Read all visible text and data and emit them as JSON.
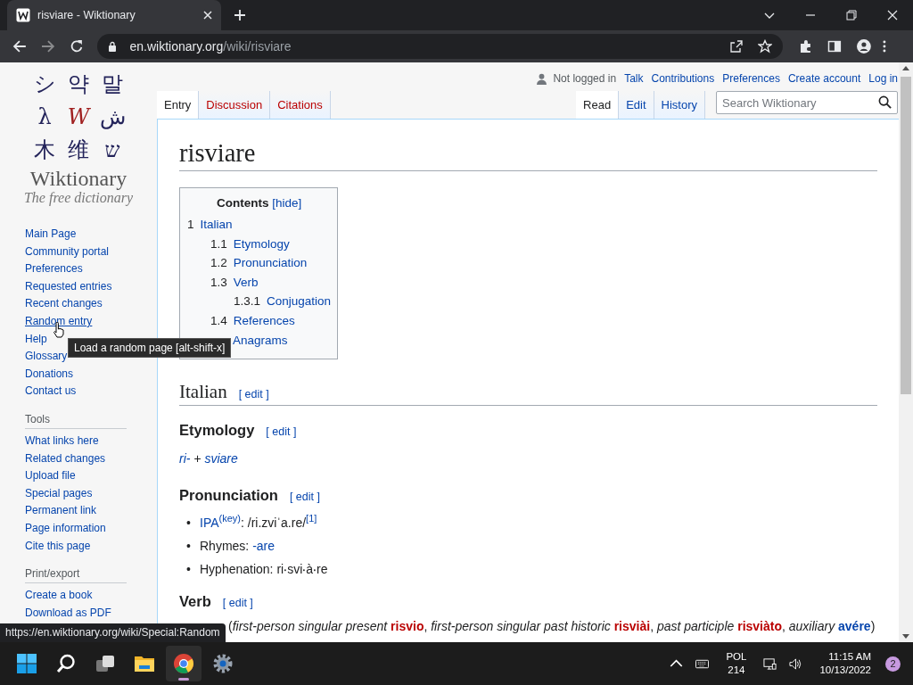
{
  "browser": {
    "tab_title": "risviare - Wiktionary",
    "url_host": "en.wiktionary.org",
    "url_path": "/wiki/risviare"
  },
  "logo": {
    "glyphs": [
      "シ",
      "약",
      "말",
      "λ",
      "W",
      "ش",
      "木",
      "维",
      "ש"
    ],
    "name": "Wiktionary",
    "tagline": "The free dictionary"
  },
  "sidebar": [
    {
      "items": [
        {
          "label": "Main Page",
          "hovered": false
        },
        {
          "label": "Community portal",
          "hovered": false
        },
        {
          "label": "Preferences",
          "hovered": false
        },
        {
          "label": "Requested entries",
          "hovered": false
        },
        {
          "label": "Recent changes",
          "hovered": false
        },
        {
          "label": "Random entry",
          "hovered": true
        },
        {
          "label": "Help",
          "hovered": false
        },
        {
          "label": "Glossary",
          "hovered": false
        },
        {
          "label": "Donations",
          "hovered": false
        },
        {
          "label": "Contact us",
          "hovered": false
        }
      ]
    },
    {
      "heading": "Tools",
      "items": [
        {
          "label": "What links here",
          "hovered": false
        },
        {
          "label": "Related changes",
          "hovered": false
        },
        {
          "label": "Upload file",
          "hovered": false
        },
        {
          "label": "Special pages",
          "hovered": false
        },
        {
          "label": "Permanent link",
          "hovered": false
        },
        {
          "label": "Page information",
          "hovered": false
        },
        {
          "label": "Cite this page",
          "hovered": false
        }
      ]
    },
    {
      "heading": "Print/export",
      "items": [
        {
          "label": "Create a book",
          "hovered": false
        },
        {
          "label": "Download as PDF",
          "hovered": false
        }
      ]
    }
  ],
  "personal": {
    "status": "Not logged in",
    "links": [
      "Talk",
      "Contributions",
      "Preferences",
      "Create account",
      "Log in"
    ]
  },
  "left_tabs": [
    {
      "label": "Entry",
      "selected": true,
      "missing": false
    },
    {
      "label": "Discussion",
      "selected": false,
      "missing": true
    },
    {
      "label": "Citations",
      "selected": false,
      "missing": true
    }
  ],
  "right_tabs": [
    {
      "label": "Read",
      "selected": true
    },
    {
      "label": "Edit",
      "selected": false
    },
    {
      "label": "History",
      "selected": false
    }
  ],
  "search": {
    "placeholder": "Search Wiktionary"
  },
  "title": "risviare",
  "toc": {
    "title": "Contents",
    "toggle": "[hide]",
    "items": [
      {
        "number": "1",
        "label": "Italian",
        "children": [
          {
            "number": "1.1",
            "label": "Etymology"
          },
          {
            "number": "1.2",
            "label": "Pronunciation"
          },
          {
            "number": "1.3",
            "label": "Verb",
            "children": [
              {
                "number": "1.3.1",
                "label": "Conjugation"
              }
            ]
          },
          {
            "number": "1.4",
            "label": "References"
          },
          {
            "label": "Anagrams"
          }
        ]
      }
    ]
  },
  "blocks": [
    {
      "kind": "heading2",
      "title": "Italian",
      "edit": "[ edit ]"
    },
    {
      "kind": "heading3",
      "title": "Etymology",
      "edit": "[ edit ]"
    },
    {
      "kind": "paragraph",
      "segments": [
        {
          "text": "ri-",
          "kind": "link-italic"
        },
        {
          "text": " + ",
          "kind": "italic"
        },
        {
          "text": "sviare",
          "kind": "link-italic"
        }
      ]
    },
    {
      "kind": "heading3",
      "title": "Pronunciation",
      "edit": "[ edit ]"
    },
    {
      "kind": "bullets",
      "bullet": "•",
      "items": [
        [
          {
            "text": "IPA",
            "kind": "link"
          },
          {
            "text": "(key)",
            "kind": "sup-link"
          },
          {
            "text": ": /ri.zviˈa.re/",
            "kind": "plain"
          },
          {
            "text": "[1]",
            "kind": "sup-link"
          }
        ],
        [
          {
            "text": "Rhymes: ",
            "kind": "plain"
          },
          {
            "text": "-are",
            "kind": "link"
          }
        ],
        [
          {
            "text": "Hyphenation: ri‧svi‧à‧re",
            "kind": "plain"
          }
        ]
      ]
    },
    {
      "kind": "heading3",
      "title": "Verb",
      "edit": "[ edit ]"
    },
    {
      "kind": "headword-line",
      "segments": [
        {
          "text": "(",
          "kind": "plain"
        },
        {
          "text": "first-person singular present ",
          "kind": "italic"
        },
        {
          "text": "risvio",
          "kind": "redlink-bold"
        },
        {
          "text": ", ",
          "kind": "plain"
        },
        {
          "text": "first-person singular past historic ",
          "kind": "italic"
        },
        {
          "text": "risviài",
          "kind": "redlink-bold"
        },
        {
          "text": ", ",
          "kind": "plain"
        },
        {
          "text": "past participle ",
          "kind": "italic"
        },
        {
          "text": "risviàto",
          "kind": "redlink-bold"
        },
        {
          "text": ", ",
          "kind": "plain"
        },
        {
          "text": "auxiliary ",
          "kind": "italic"
        },
        {
          "text": "avére",
          "kind": "link-bold"
        },
        {
          "text": ")",
          "kind": "plain"
        }
      ]
    }
  ],
  "tooltip": "Load a random page [alt-shift-x]",
  "status_url": "https://en.wiktionary.org/wiki/Special:Random",
  "taskbar": {
    "apps": [
      {
        "kind": "start",
        "active": false
      },
      {
        "kind": "search",
        "active": false
      },
      {
        "kind": "taskview",
        "active": false
      },
      {
        "kind": "folder",
        "active": false
      },
      {
        "kind": "chrome",
        "active": true
      },
      {
        "kind": "settings",
        "active": false
      }
    ],
    "language": "POL",
    "layout": "214",
    "time": "11:15 AM",
    "date": "10/13/2022",
    "notifications": "2"
  }
}
